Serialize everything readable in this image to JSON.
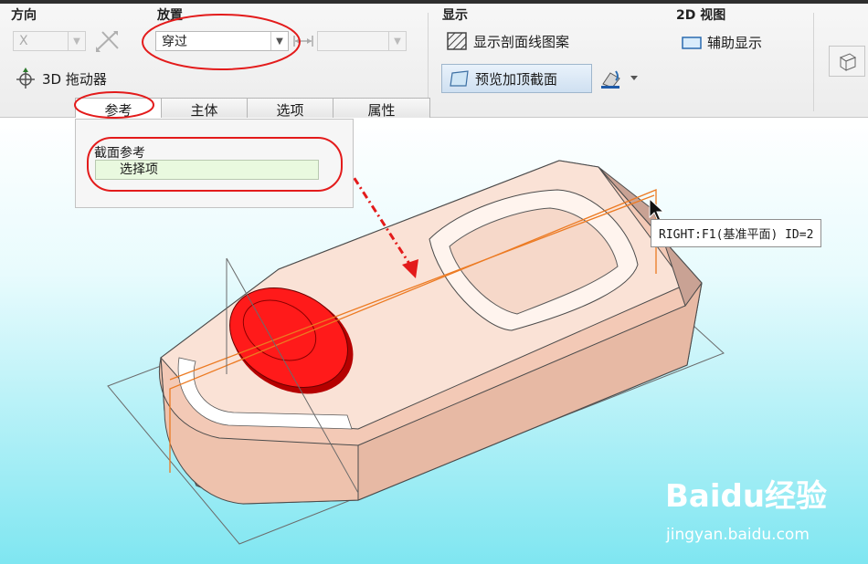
{
  "ribbon": {
    "direction": {
      "title": "方向",
      "axis_value": "X",
      "dragger_label": "3D 拖动器"
    },
    "placement": {
      "title": "放置",
      "mode_value": "穿过",
      "offset_value": ""
    },
    "display": {
      "title": "显示",
      "hatch_label": "显示剖面线图案",
      "preview_label": "预览加顶截面"
    },
    "view2d": {
      "title": "2D 视图",
      "aux_label": "辅助显示"
    }
  },
  "tabs": [
    {
      "label": "参考"
    },
    {
      "label": "主体"
    },
    {
      "label": "选项"
    },
    {
      "label": "属性"
    }
  ],
  "panel": {
    "label": "截面参考",
    "field_value": "选择项"
  },
  "tooltip": {
    "text": "RIGHT:F1(基准平面) ID=2"
  },
  "watermark": {
    "brand": "Baidu经验",
    "url": "jingyan.baidu.com"
  },
  "colors": {
    "annotation": "#e31b1b",
    "part_fill": "#f6d9cc",
    "button_feature": "#e60000",
    "datum_line": "#ec7a22",
    "background_bottom": "#7fe6f1"
  }
}
